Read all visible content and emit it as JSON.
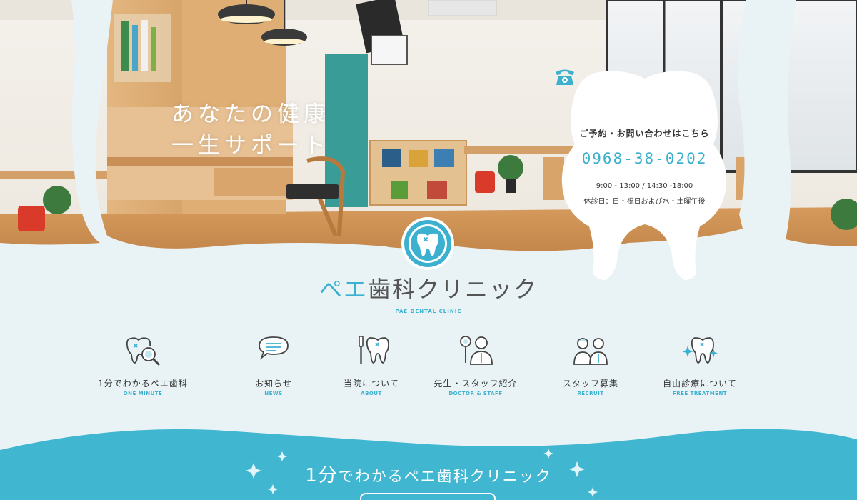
{
  "hero": {
    "catch_line1": "あなたの健康",
    "catch_line2": "一生サポート"
  },
  "contact": {
    "icon": "telephone-icon",
    "title": "ご予約・お問い合わせはこちら",
    "phone": "0968-38-0202",
    "hours": "9:00 - 13:00 / 14:30 -18:00",
    "closed": "休診日：日・祝日および水・土曜午後"
  },
  "logo": {
    "name_accent": "ペエ",
    "name_rest": "歯科クリニック",
    "subtitle": "PAE DENTAL CLINIC"
  },
  "nav": {
    "items": [
      {
        "jp": "1分でわかるペエ歯科",
        "en": "ONE MINUTE",
        "icon": "tooth-magnifier-icon"
      },
      {
        "jp": "お知らせ",
        "en": "NEWS",
        "icon": "speech-bubble-icon"
      },
      {
        "jp": "当院について",
        "en": "ABOUT",
        "icon": "toothbrush-tooth-icon"
      },
      {
        "jp": "先生・スタッフ紹介",
        "en": "DOCTOR & STAFF",
        "icon": "doctor-icon"
      },
      {
        "jp": "スタッフ募集",
        "en": "RECRUIT",
        "icon": "staff-people-icon"
      },
      {
        "jp": "自由診療について",
        "en": "FREE TREATMENT",
        "icon": "sparkle-tooth-icon"
      }
    ]
  },
  "band": {
    "title_num": "1",
    "title_big": "分",
    "title_rest": "でわかるペエ歯科クリニック"
  },
  "colors": {
    "accent": "#3bb1cf",
    "band": "#41b6d0",
    "background": "#e9f3f6"
  }
}
